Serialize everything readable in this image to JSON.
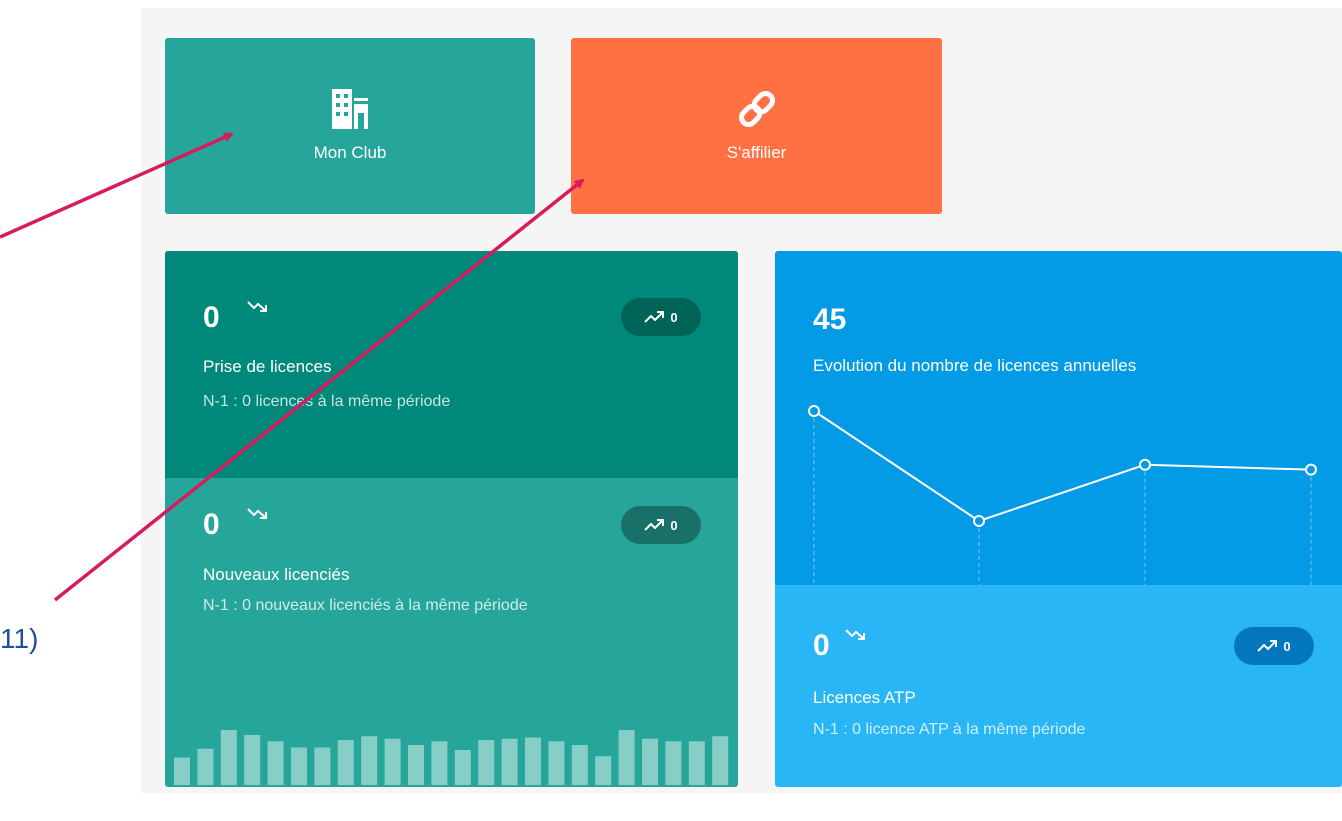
{
  "tiles": {
    "club": {
      "label": "Mon Club",
      "icon": "building-icon",
      "color": "#26a69a"
    },
    "affiliate": {
      "label": "S'affilier",
      "icon": "link-icon",
      "color": "#ff7043"
    }
  },
  "cards": {
    "prise": {
      "value": "0",
      "title": "Prise de licences",
      "subtitle": "N-1 : 0 licences à la même période",
      "badge": "0"
    },
    "nouveaux": {
      "value": "0",
      "title": "Nouveaux licenciés",
      "subtitle": "N-1 : 0 nouveaux licenciés à la même période",
      "badge": "0"
    },
    "evolution": {
      "value": "45",
      "title": "Evolution du nombre de licences annuelles"
    },
    "atp": {
      "value": "0",
      "title": "Licences ATP",
      "subtitle": "N-1 : 0 licence ATP à la même période",
      "badge": "0"
    }
  },
  "sparkline_bars": [
    22,
    29,
    44,
    40,
    35,
    30,
    30,
    36,
    39,
    37,
    32,
    35,
    28,
    36,
    37,
    38,
    35,
    32,
    23,
    44,
    37,
    35,
    35,
    39
  ],
  "line_chart": {
    "values": [
      5.0,
      0.5,
      2.8,
      2.6
    ]
  },
  "annotation": {
    "label": "11)"
  },
  "colors": {
    "teal_dark": "#00897b",
    "teal": "#26a69a",
    "orange": "#ff7043",
    "blue": "#039be5",
    "light_blue": "#29b6f6",
    "arrow": "#d81b60",
    "annotation_text": "#1f4e9c"
  }
}
